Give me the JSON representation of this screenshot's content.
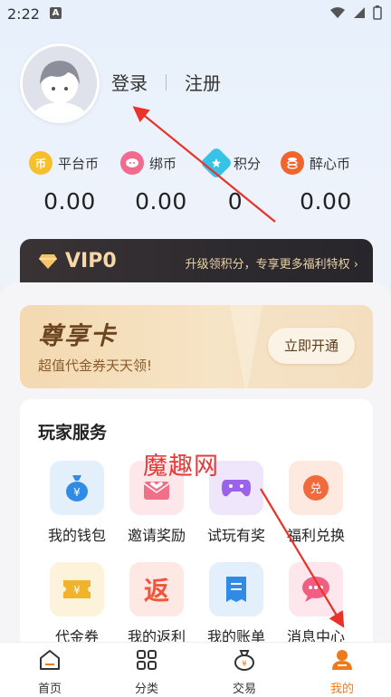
{
  "status_bar": {
    "time": "2:22",
    "app_badge": "A"
  },
  "profile": {
    "login_label": "登录",
    "register_label": "注册"
  },
  "currencies": [
    {
      "name": "平台币",
      "value": "0.00",
      "icon": "coin-icon",
      "color": "#f5c02c",
      "glyph": "币"
    },
    {
      "name": "绑币",
      "value": "0.00",
      "icon": "pig-icon",
      "color": "#f26a8d",
      "glyph": ""
    },
    {
      "name": "积分",
      "value": "0",
      "icon": "star-badge-icon",
      "color": "#39c2e8",
      "glyph": ""
    },
    {
      "name": "醉心币",
      "value": "0.00",
      "icon": "stack-coin-icon",
      "color": "#f0642e",
      "glyph": ""
    }
  ],
  "vip": {
    "level": "VIP0",
    "promo": "升级领积分，专享更多福利特权"
  },
  "card": {
    "title": "尊享卡",
    "subtitle": "超值代金券天天领!",
    "button": "立即开通"
  },
  "services": {
    "title": "玩家服务",
    "items": [
      {
        "label": "我的钱包",
        "icon": "wallet-icon",
        "bg": "#e3f0fb",
        "fg": "#2f8be6",
        "glyph": "¥"
      },
      {
        "label": "邀请奖励",
        "icon": "invite-icon",
        "bg": "#fde7ea",
        "fg": "#f07088",
        "glyph": "♥"
      },
      {
        "label": "试玩有奖",
        "icon": "gamepad-icon",
        "bg": "#efe6fb",
        "fg": "#9a63ea",
        "glyph": "••"
      },
      {
        "label": "福利兑换",
        "icon": "exchange-icon",
        "bg": "#fde9e0",
        "fg": "#f26a3a",
        "glyph": "兑"
      },
      {
        "label": "代金券",
        "icon": "voucher-icon",
        "bg": "#fdf2da",
        "fg": "#f0b32a",
        "glyph": "¥"
      },
      {
        "label": "我的返利",
        "icon": "rebate-icon",
        "bg": "#fde8e3",
        "fg": "#f0573a",
        "glyph": "返"
      },
      {
        "label": "我的账单",
        "icon": "bill-icon",
        "bg": "#e3f0fb",
        "fg": "#2f8be6",
        "glyph": "≡"
      },
      {
        "label": "消息中心",
        "icon": "message-icon",
        "bg": "#fde6ec",
        "fg": "#f05f82",
        "glyph": "•••"
      }
    ]
  },
  "watermark": "魔趣网",
  "nav": [
    {
      "label": "首页",
      "icon": "home-icon"
    },
    {
      "label": "分类",
      "icon": "grid-icon"
    },
    {
      "label": "交易",
      "icon": "money-bag-icon"
    },
    {
      "label": "我的",
      "icon": "profile-icon"
    }
  ],
  "colors": {
    "accent": "#f07a1a",
    "annotation": "#e8332a",
    "vip_gold": "#f6d9a6"
  }
}
